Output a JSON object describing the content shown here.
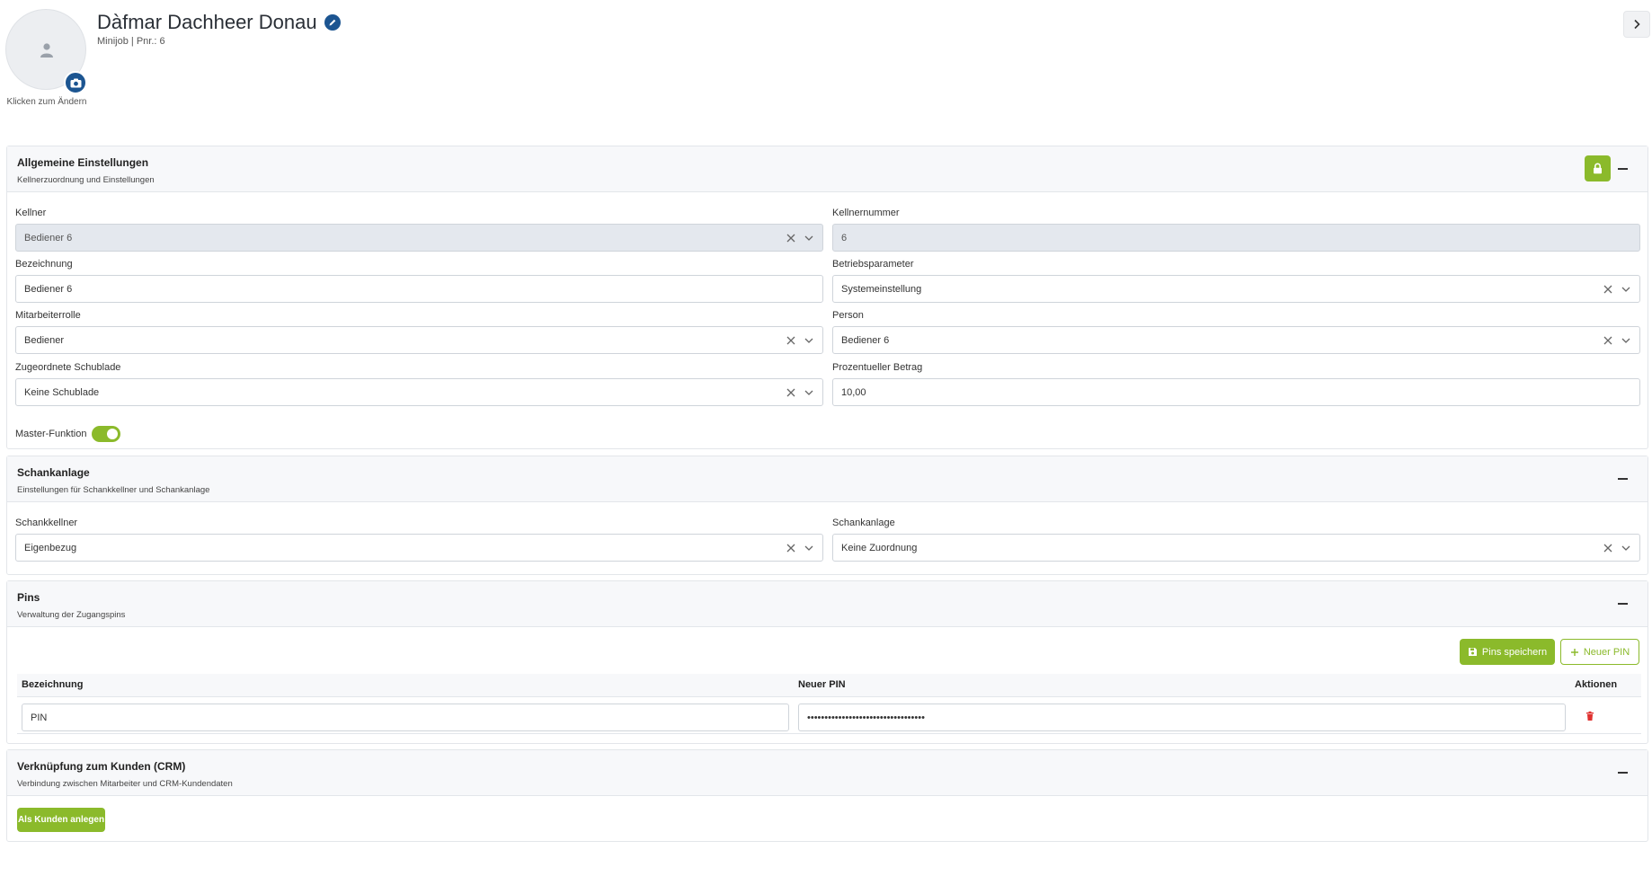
{
  "header": {
    "name": "Dàfmar Dachheer Donau",
    "subtitle": "Minijob | Pnr.: 6",
    "avatar_hint": "Klicken zum Ändern"
  },
  "sections": {
    "general": {
      "title": "Allgemeine Einstellungen",
      "subtitle": "Kellnerzuordnung und Einstellungen",
      "fields": {
        "kellner": {
          "label": "Kellner",
          "value": "Bediener 6"
        },
        "kellnernummer": {
          "label": "Kellnernummer",
          "value": "6"
        },
        "bezeichnung": {
          "label": "Bezeichnung",
          "value": "Bediener 6"
        },
        "betriebsparameter": {
          "label": "Betriebsparameter",
          "value": "Systemeinstellung"
        },
        "mitarbeiterrolle": {
          "label": "Mitarbeiterrolle",
          "value": "Bediener"
        },
        "person": {
          "label": "Person",
          "value": "Bediener 6"
        },
        "schublade": {
          "label": "Zugeordnete Schublade",
          "value": "Keine Schublade"
        },
        "prozent": {
          "label": "Prozentueller Betrag",
          "value": "10,00"
        }
      },
      "master_label": "Master-Funktion",
      "master_on": true
    },
    "schank": {
      "title": "Schankanlage",
      "subtitle": "Einstellungen für Schankkellner und Schankanlage",
      "fields": {
        "schankkellner": {
          "label": "Schankkellner",
          "value": "Eigenbezug"
        },
        "schankanlage": {
          "label": "Schankanlage",
          "value": "Keine Zuordnung"
        }
      }
    },
    "pins": {
      "title": "Pins",
      "subtitle": "Verwaltung der Zugangspins",
      "save_label": "Pins speichern",
      "new_label": "Neuer PIN",
      "columns": [
        "Bezeichnung",
        "Neuer PIN",
        "Aktionen"
      ],
      "rows": [
        {
          "bezeichnung": "PIN",
          "pin": "••••••••••••••••••••••••••••••••••"
        }
      ]
    },
    "crm": {
      "title": "Verknüpfung zum Kunden (CRM)",
      "subtitle": "Verbindung zwischen Mitarbeiter und CRM-Kundendaten",
      "button_label": "Als Kunden anlegen"
    }
  },
  "colors": {
    "accent": "#8bba2b",
    "brand": "#1c5591",
    "danger": "#e0312f"
  }
}
